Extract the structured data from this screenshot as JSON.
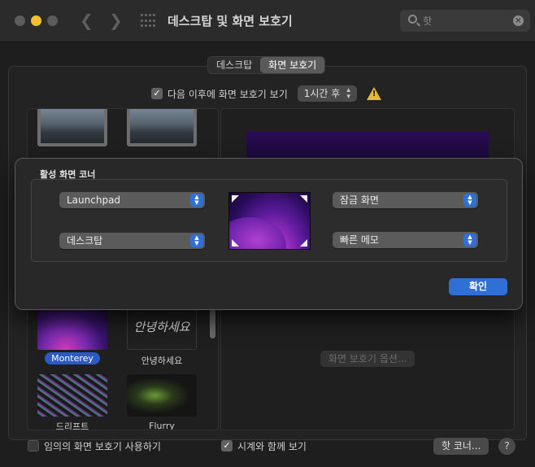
{
  "window": {
    "title": "데스크탑 및 화면 보호기"
  },
  "search": {
    "value": "핫"
  },
  "tabs": [
    {
      "label": "데스크탑"
    },
    {
      "label": "화면 보호기"
    }
  ],
  "settings": {
    "start_after_label": "다음 이후에 화면 보호기 보기",
    "start_after_value": "1시간 후",
    "random_label": "임의의 화면 보호기 사용하기",
    "show_clock_label": "시계와 함께 보기",
    "options_button": "화면 보호기 옵션...",
    "hot_corners_button": "핫 코너...",
    "help_button": "?"
  },
  "screensavers": [
    {
      "label": "Monterey",
      "selected": true
    },
    {
      "label": "안녕하세요",
      "preview_text": "안녕하세요"
    },
    {
      "label": "드리프트"
    },
    {
      "label": "Flurry"
    }
  ],
  "sheet": {
    "group_title": "활성 화면 코너",
    "top_left": "Launchpad",
    "bottom_left": "데스크탑",
    "top_right": "잠금 화면",
    "bottom_right": "빠른 메모",
    "ok_button": "확인"
  },
  "colors": {
    "accent": "#2f6fd6",
    "window_bg": "#1e1e1e",
    "warning": "#e7b832"
  }
}
